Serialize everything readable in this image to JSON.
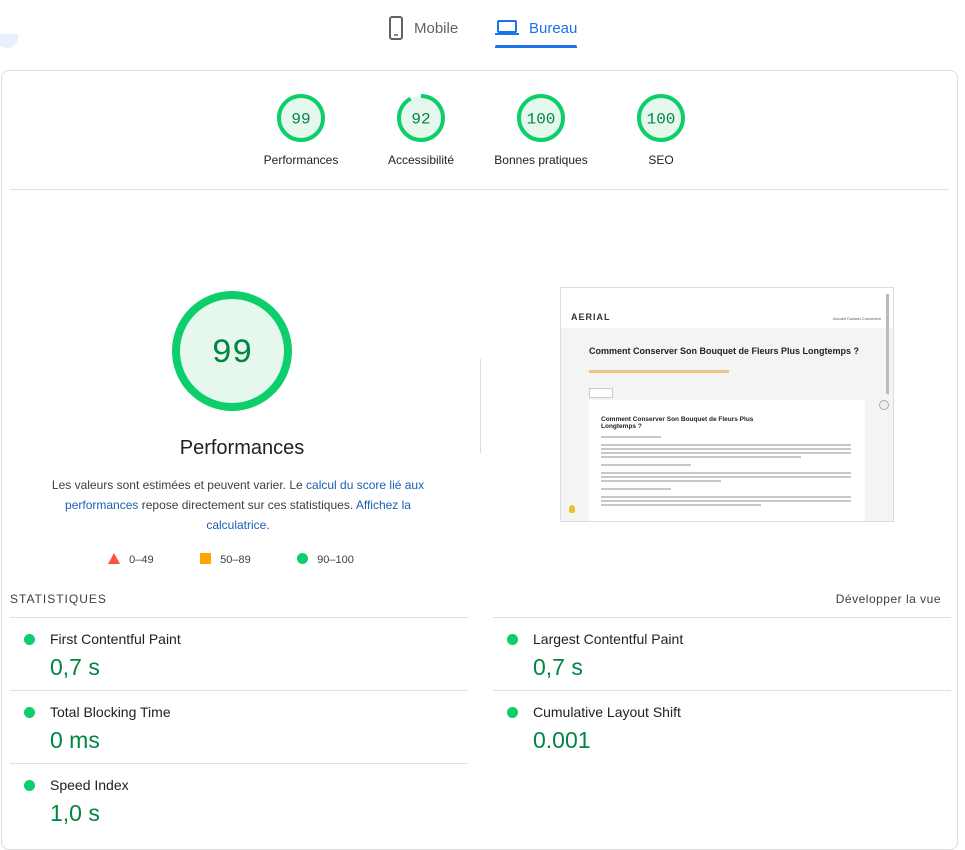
{
  "tabs": {
    "mobile": "Mobile",
    "desktop": "Bureau"
  },
  "colors": {
    "pass": "#0cce6b",
    "pass_text": "#018642",
    "average": "#ffa400",
    "fail": "#ff4e42",
    "accent": "#1a73e8"
  },
  "categories": [
    {
      "score": "99",
      "label": "Performances"
    },
    {
      "score": "92",
      "label": "Accessibilité"
    },
    {
      "score": "100",
      "label": "Bonnes pratiques"
    },
    {
      "score": "100",
      "label": "SEO"
    }
  ],
  "main": {
    "score": "99",
    "title": "Performances",
    "desc_1": "Les valeurs sont estimées et peuvent varier. Le ",
    "link_1": "calcul du score lié aux performances",
    "desc_2": " repose directement sur ces statistiques. ",
    "link_2": "Affichez la calculatrice",
    "desc_3": "."
  },
  "legend": {
    "fail": "0–49",
    "average": "50–89",
    "pass": "90–100"
  },
  "thumbnail": {
    "logo_a": "AERIAL",
    "logo_b": "",
    "nav": "Accueil   Contact   Connexion",
    "heading": "Comment Conserver Son Bouquet de Fleurs Plus Longtemps ?",
    "article_heading": "Comment Conserver Son Bouquet de Fleurs Plus Longtemps ?"
  },
  "stats": {
    "header": "STATISTIQUES",
    "expand": "Développer la vue",
    "metrics": [
      {
        "name": "First Contentful Paint",
        "value": "0,7 s"
      },
      {
        "name": "Largest Contentful Paint",
        "value": "0,7 s"
      },
      {
        "name": "Total Blocking Time",
        "value": "0 ms"
      },
      {
        "name": "Cumulative Layout Shift",
        "value": "0.001"
      },
      {
        "name": "Speed Index",
        "value": "1,0 s"
      }
    ]
  }
}
